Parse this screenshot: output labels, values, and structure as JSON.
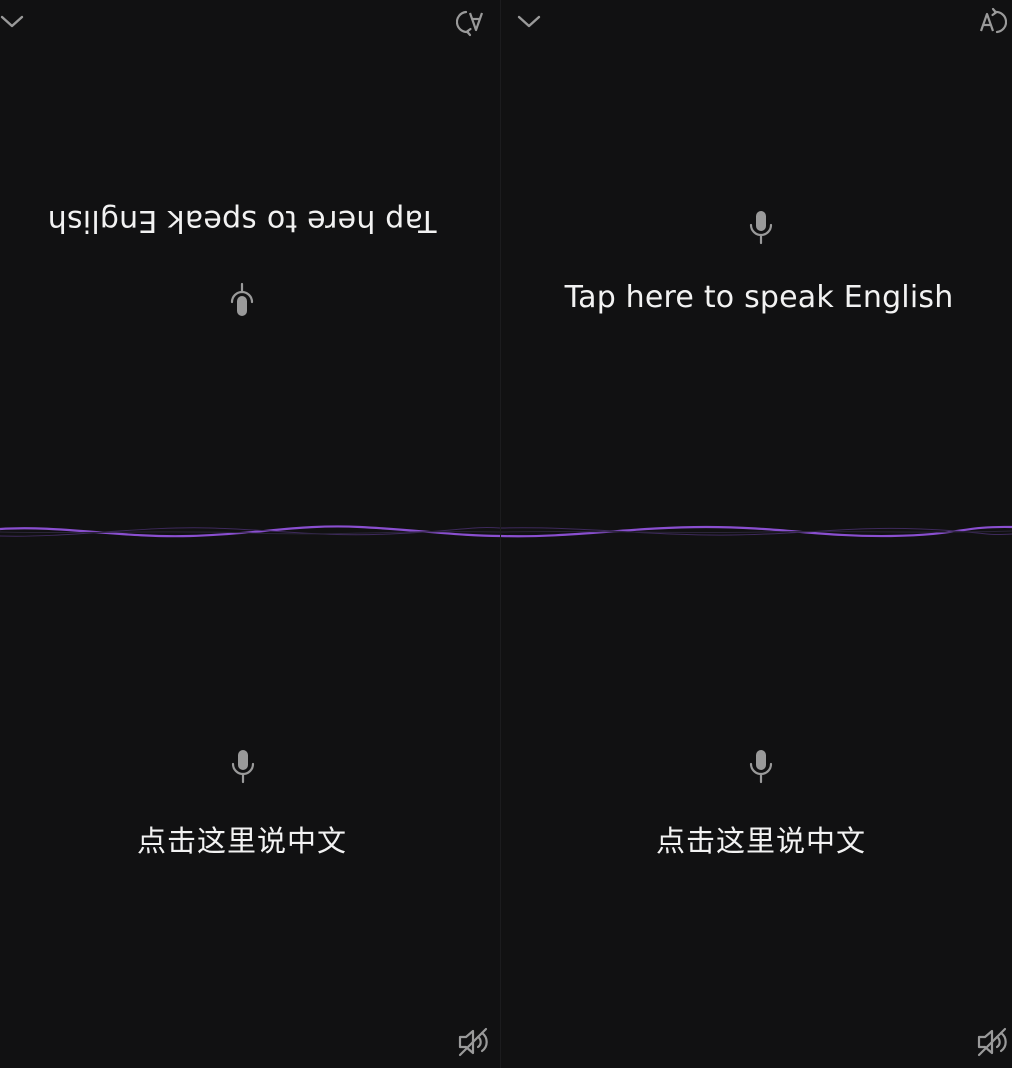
{
  "left_pane": {
    "english_prompt": "Tap here to speak English",
    "chinese_prompt": "点击这里说中文",
    "top_right_icon": "rotate-text-icon",
    "top_left_icon": "chevron-down-icon",
    "bottom_right_icon": "speaker-muted-icon",
    "mic_icon": "microphone-icon"
  },
  "right_pane": {
    "english_prompt": "Tap here to speak English",
    "chinese_prompt": "点击这里说中文",
    "top_right_icon": "rotate-text-icon",
    "top_left_icon": "chevron-down-icon",
    "bottom_right_icon": "speaker-muted-icon",
    "mic_icon": "microphone-icon"
  },
  "colors": {
    "background": "#111112",
    "wave_accent": "#8a4fd0",
    "text": "#f2f2f2",
    "icon": "#9a9a9a"
  }
}
